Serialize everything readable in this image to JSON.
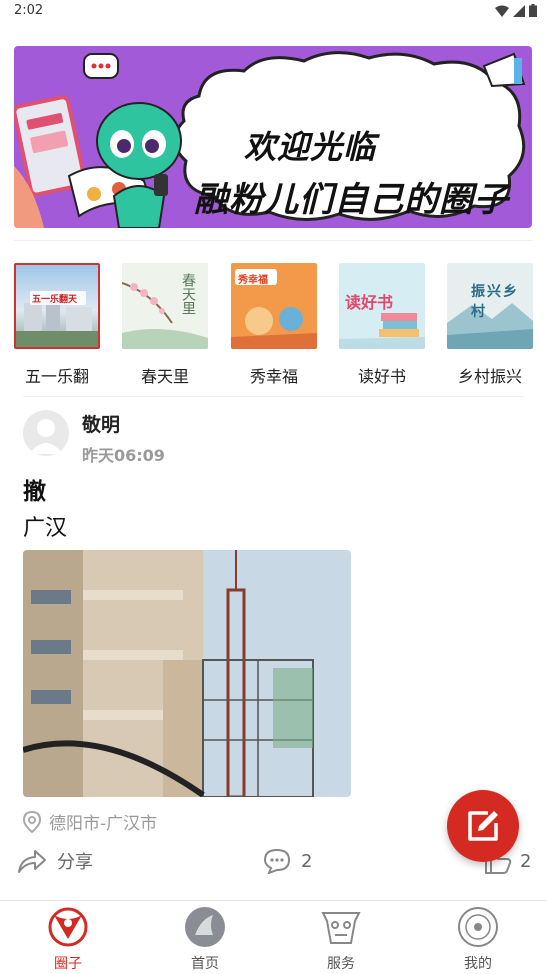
{
  "status_bar": {
    "time": "2:02"
  },
  "banner": {
    "line1": "欢迎光临",
    "line2": "融粉儿们自己的圈子"
  },
  "categories": [
    {
      "label": "五一乐翻",
      "thumb_text": "五一乐翻天"
    },
    {
      "label": "春天里",
      "thumb_text": "春天里"
    },
    {
      "label": "秀幸福",
      "thumb_text": "秀幸福"
    },
    {
      "label": "读好书",
      "thumb_text": "读好书"
    },
    {
      "label": "乡村振兴",
      "thumb_text": "振兴乡村"
    }
  ],
  "post": {
    "username": "敬明",
    "time": "昨天06:09",
    "title": "撤",
    "body": "广汉",
    "location": "德阳市-广汉市",
    "share_label": "分享",
    "comment_count": "2",
    "like_count": "2"
  },
  "tabs": [
    {
      "label": "圈子",
      "active": true
    },
    {
      "label": "首页",
      "active": false
    },
    {
      "label": "服务",
      "active": false
    },
    {
      "label": "我的",
      "active": false
    }
  ],
  "colors": {
    "accent": "#d42a22",
    "banner_bg": "#a35ad8",
    "muted": "#9a9a9a"
  }
}
